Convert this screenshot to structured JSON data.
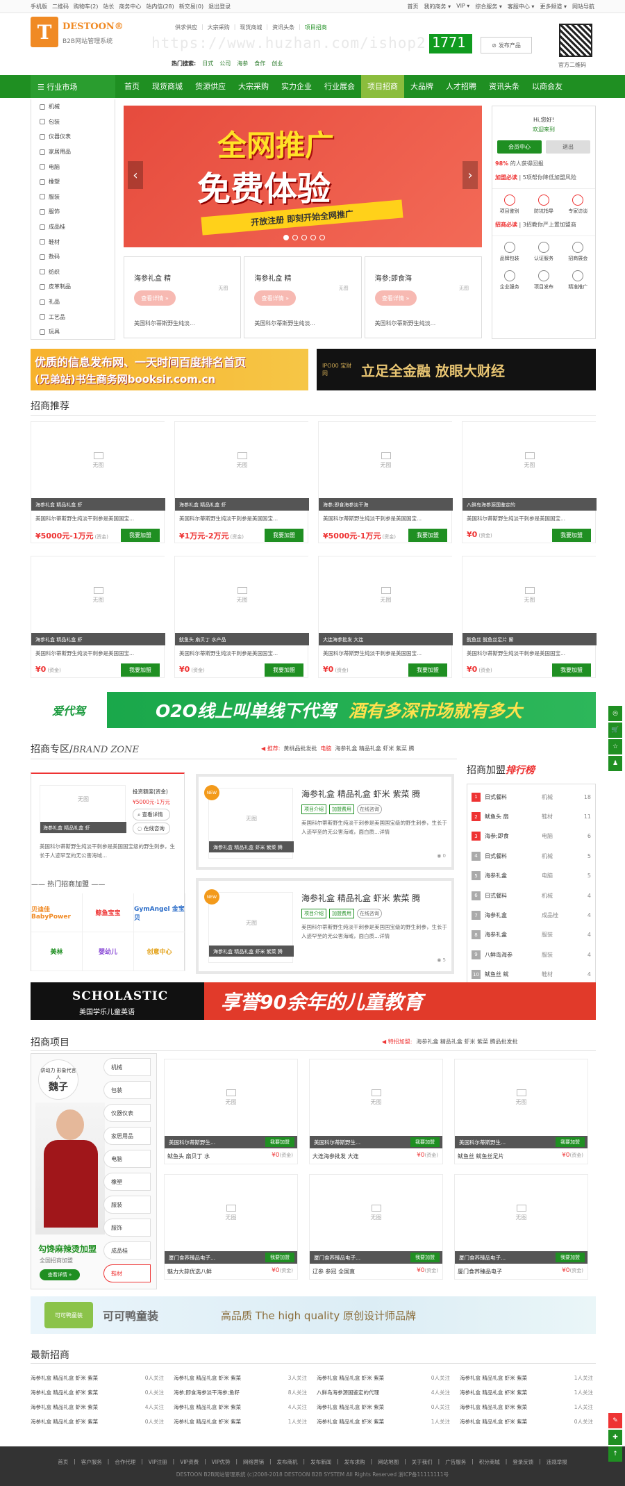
{
  "topbar": {
    "left": [
      "手机版",
      "二维码",
      "购物车(2)",
      "站长",
      "商务中心",
      "站内信(28)",
      "新交易(0)",
      "退出登录"
    ],
    "right": [
      "首页",
      "我的商务 ▾",
      "VIP ▾",
      "综合服务 ▾",
      "客服中心 ▾",
      "更多频道 ▾",
      "网站导航"
    ]
  },
  "header": {
    "logo_letter": "T",
    "logo_name": "DESTOON®",
    "logo_sub": "B2B网站管理系统",
    "subnav": [
      "供求供应",
      "大宗采购",
      "现货商城",
      "资讯头条",
      "项目招商"
    ],
    "watermark": "https://www.huzhan.com/ishop2",
    "watermark_box": "1771",
    "post_button": "发布产品",
    "hot_label": "热门搜索:",
    "hot_terms": [
      "日式",
      "公司",
      "海参",
      "食作",
      "创业"
    ],
    "qr_label": "官方二维码"
  },
  "nav": {
    "category": "☰ 行业市场",
    "items": [
      "首页",
      "现货商城",
      "货源供应",
      "大宗采购",
      "实力企业",
      "行业展会",
      "项目招商",
      "大品牌",
      "人才招聘",
      "资讯头条",
      "以商会友"
    ],
    "active_index": 6
  },
  "categories": [
    "机械",
    "包装",
    "仪器仪表",
    "家居用品",
    "电脑",
    "橡塑",
    "服装",
    "服饰",
    "成品桂",
    "鞋材",
    "数码",
    "纺织",
    "皮革制品",
    "礼品",
    "工艺品",
    "玩具"
  ],
  "banner": {
    "line1": "全网推广",
    "line2": "免费体验",
    "ribbon": "开放注册  即刻开始全网推广",
    "prev": "‹",
    "next": "›"
  },
  "product_cards": [
    {
      "title": "海参礼盒 精",
      "button": "查看详情 »",
      "desc": "美国科尔蒂斯野生纯淡...",
      "placeholder": "无图"
    },
    {
      "title": "海参礼盒 精",
      "button": "查看详情 »",
      "desc": "美国科尔蒂斯野生纯淡...",
      "placeholder": "无图"
    },
    {
      "title": "海参;即食海",
      "button": "查看详情 »",
      "desc": "美国科尔蒂斯野生纯淡...",
      "placeholder": "无图"
    }
  ],
  "user_panel": {
    "hi": "Hi,您好!",
    "welcome": "欢迎来到",
    "login": "会员中心",
    "logout": "退出",
    "stat_prefix": "98%",
    "stat_text": "的人获得回报",
    "join_label": "加盟必读",
    "join_text": "5项帮你降低加盟风险",
    "row1": [
      "项目鉴别",
      "防坑指导",
      "专家访谈"
    ],
    "invest_label": "招商必读",
    "invest_text": "3招教你严上置加盟商",
    "row2": [
      "品牌包装",
      "认证服务",
      "招商展会"
    ],
    "row3": [
      "企业服务",
      "项目发布",
      "精准推广"
    ]
  },
  "ads": {
    "ad1_line1": "优质的信息发布网、一天时间百度排名首页",
    "ad1_line2": "(兄弟站)书生商务网booksir.com.cn",
    "ad2_brand": "IPO00 宝财网",
    "ad2_text": "立足全金融  放眼大财经",
    "ad3_logo": "爱代驾",
    "ad3_text": "O2O线上叫单线下代驾",
    "ad3_text2": "酒有多深市场就有多大",
    "ad4_brand": "SCHOLASTIC",
    "ad4_sub": "美国学乐儿童英语",
    "ad4_text": "享誉90余年的儿童教育",
    "ad5_logo": "可可鸭童装",
    "ad5_text": "可可鸭童装",
    "ad5_text2": "高品质 The high quality 原创设计师品牌"
  },
  "recommend": {
    "title": "招商推荐",
    "cards": [
      {
        "bar": "海参礼盒 精品礼盒 虾",
        "desc": "美国科尔蒂斯野生纯淡干刺参是美国国宝...",
        "price": "¥5000元-1万元",
        "unit": "(资金)",
        "join": "我要加盟"
      },
      {
        "bar": "海参礼盒 精品礼盒 虾",
        "desc": "美国科尔蒂斯野生纯淡干刺参是美国国宝...",
        "price": "¥1万元-2万元",
        "unit": "(资金)",
        "join": "我要加盟"
      },
      {
        "bar": "海参;即食海参淡干海",
        "desc": "美国科尔蒂斯野生纯淡干刺参是美国国宝...",
        "price": "¥5000元-1万元",
        "unit": "(资金)",
        "join": "我要加盟"
      },
      {
        "bar": "八鲜岛海参源国鉴定的",
        "desc": "美国科尔蒂斯野生纯淡干刺参是美国国宝...",
        "price": "¥0",
        "unit": "(资金)",
        "join": "我要加盟"
      },
      {
        "bar": "海参礼盒 精品礼盒 虾",
        "desc": "美国科尔蒂斯野生纯淡干刺参是美国国宝...",
        "price": "¥0",
        "unit": "(资金)",
        "join": "我要加盟"
      },
      {
        "bar": "鱿鱼头 扇贝丁 水产品",
        "desc": "美国科尔蒂斯野生纯淡干刺参是美国国宝...",
        "price": "¥0",
        "unit": "(资金)",
        "join": "我要加盟"
      },
      {
        "bar": "大连海参批发 大连",
        "desc": "美国科尔蒂斯野生纯淡干刺参是美国国宝...",
        "price": "¥0",
        "unit": "(资金)",
        "join": "我要加盟"
      },
      {
        "bar": "鱿鱼丝 鱿鱼丝足片 鱀",
        "desc": "美国科尔蒂斯野生纯淡干刺参是美国国宝...",
        "price": "¥0",
        "unit": "(资金)",
        "join": "我要加盟"
      }
    ],
    "placeholder": "无图"
  },
  "brand": {
    "title": "招商专区/",
    "title_en": "BRAND ZONE",
    "nav_label": "◀ 推荐:",
    "nav_items": [
      "黄桃品批发批",
      "电脑",
      "海参礼盒 精品礼盒 虾米 紫菜 腾"
    ],
    "left": {
      "bar": "海参礼盒 精品礼盒 虾",
      "invest": "投资额度(资金)",
      "price": "¥5000元-1万元",
      "detail": "查看详情",
      "consult": "在线咨询",
      "desc": "美国科尔蒂斯野生纯淡干刺参是美国国宝级的野生刺参，生长于人迹罕至的无公害海域...",
      "hot": "—— 热门招商加盟 ——",
      "logos": [
        "贝迪佳 BabyPower",
        "鲸鱼宝宝",
        "GymAngel 金宝贝",
        "美林",
        "婴幼儿",
        "创意中心"
      ]
    },
    "cards": [
      {
        "badge": "NEW",
        "bar": "海参礼盒 精品礼盒 虾米 紫菜 腾",
        "title": "海参礼盒 精品礼盒 虾米 紫菜 腾",
        "tags": [
          "项目介绍",
          "加盟费用",
          "在线咨询"
        ],
        "desc": "美国科尔蒂斯野生纯淡干刺参是美国国宝级的野生刺参，生长于人迹罕至的无公害海域，面白质...详情",
        "views": "0"
      },
      {
        "badge": "NEW",
        "bar": "海参礼盒 精品礼盒 虾米 紫菜 腾",
        "title": "海参礼盒 精品礼盒 虾米 紫菜 腾",
        "tags": [
          "项目介绍",
          "加盟费用",
          "在线咨询"
        ],
        "desc": "美国科尔蒂斯野生纯淡干刺参是美国国宝级的野生刺参，生长于人迹罕至的无公害海域，面白质...详情",
        "views": "5"
      }
    ],
    "placeholder": "无图"
  },
  "rank": {
    "title": "招商加盟",
    "title_em": "排行榜",
    "items": [
      {
        "n": "1",
        "name": "日式餐料",
        "cat": "机械",
        "v": "18"
      },
      {
        "n": "2",
        "name": "鱿鱼头 扇",
        "cat": "鞋材",
        "v": "11"
      },
      {
        "n": "3",
        "name": "海参;即食",
        "cat": "电脑",
        "v": "6"
      },
      {
        "n": "4",
        "name": "日式餐料",
        "cat": "机械",
        "v": "5"
      },
      {
        "n": "5",
        "name": "海参礼盒",
        "cat": "电脑",
        "v": "5"
      },
      {
        "n": "6",
        "name": "日式餐料",
        "cat": "机械",
        "v": "4"
      },
      {
        "n": "7",
        "name": "海参礼盒",
        "cat": "成品桂",
        "v": "4"
      },
      {
        "n": "8",
        "name": "海参礼盒",
        "cat": "服装",
        "v": "4"
      },
      {
        "n": "9",
        "name": "八鲜岛海参",
        "cat": "服装",
        "v": "4"
      },
      {
        "n": "10",
        "name": "鱿鱼丝 鱿",
        "cat": "鞋材",
        "v": "4"
      }
    ]
  },
  "projects": {
    "title": "招商项目",
    "nav_label": "◀ 特招加盟:",
    "nav_text": "海参礼盒 精品礼盒 虾米 紫菜 腾品批发批",
    "sign_text": "讲动力 形象代言人",
    "sign_name": "魏子",
    "promo_name": "勾馋麻辣烫加盟",
    "promo_desc": "全国招商加盟",
    "promo_btn": "查看详情 »",
    "tabs": [
      "机械",
      "包装",
      "仪器仪表",
      "家居用品",
      "电脑",
      "橡塑",
      "服装",
      "服饰",
      "成品桂",
      "鞋材"
    ],
    "active_tab": 9,
    "cells": [
      {
        "bar": "美国科尔蒂斯野生...",
        "join": "我要加盟",
        "name": "鱿鱼头 扇贝丁 水",
        "price": "¥0",
        "unit": "(资金)"
      },
      {
        "bar": "美国科尔蒂斯野生...",
        "join": "我要加盟",
        "name": "大连海参批发 大连",
        "price": "¥0",
        "unit": "(资金)"
      },
      {
        "bar": "美国科尔蒂斯野生...",
        "join": "我要加盟",
        "name": "鱿鱼丝 鱿鱼丝足片",
        "price": "¥0",
        "unit": "(资金)"
      },
      {
        "bar": "厦门食荞臻品电子...",
        "join": "我要加盟",
        "name": "魅力大蒜优选八鲜",
        "price": "¥0",
        "unit": "(资金)"
      },
      {
        "bar": "厦门食荞臻品电子...",
        "join": "我要加盟",
        "name": "辽参 参冠 全国直",
        "price": "¥0",
        "unit": "(资金)"
      },
      {
        "bar": "厦门食荞臻品电子...",
        "join": "我要加盟",
        "name": "厦门食荞臻品电子",
        "price": "¥0",
        "unit": "(资金)"
      }
    ],
    "placeholder": "无图"
  },
  "latest": {
    "title": "最新招商",
    "items": [
      [
        "海参礼盒 精品礼盒 虾米 紫菜",
        "0人关注"
      ],
      [
        "海参礼盒 精品礼盒 虾米 紫菜",
        "3人关注"
      ],
      [
        "海参礼盒 精品礼盒 虾米 紫菜",
        "0人关注"
      ],
      [
        "海参礼盒 精品礼盒 虾米 紫菜",
        "1人关注"
      ],
      [
        "海参礼盒 精品礼盒 虾米 紫菜",
        "0人关注"
      ],
      [
        "海参;即食海参淡干海参;鱼籽",
        "8人关注"
      ],
      [
        "八鲜岛海参源国鉴定的代理",
        "4人关注"
      ],
      [
        "海参礼盒 精品礼盒 虾米 紫菜",
        "1人关注"
      ],
      [
        "海参礼盒 精品礼盒 虾米 紫菜",
        "4人关注"
      ],
      [
        "海参礼盒 精品礼盒 虾米 紫菜",
        "4人关注"
      ],
      [
        "海参礼盒 精品礼盒 虾米 紫菜",
        "0人关注"
      ],
      [
        "海参礼盒 精品礼盒 虾米 紫菜",
        "1人关注"
      ],
      [
        "海参礼盒 精品礼盒 虾米 紫菜",
        "0人关注"
      ],
      [
        "海参礼盒 精品礼盒 虾米 紫菜",
        "1人关注"
      ],
      [
        "海参礼盒 精品礼盒 虾米 紫菜",
        "1人关注"
      ],
      [
        "海参礼盒 精品礼盒 虾米 紫菜",
        "0人关注"
      ]
    ]
  },
  "footer": {
    "links": [
      "首页",
      "客户服务",
      "合作代理",
      "VIP注册",
      "VIP资费",
      "VIP优势",
      "网络营销",
      "发布商机",
      "发布新闻",
      "发布求购",
      "网站地图",
      "关于我们",
      "广告服务",
      "积分商城",
      "登录反馈",
      "违规举报"
    ],
    "copy": "DESTOON B2B网站管理系统 (c)2008-2018 DESTOON B2B SYSTEM All Rights Reserved   浙ICP备11111111号"
  },
  "side_float": [
    "◎",
    "🛒",
    "☆",
    "♟"
  ],
  "side_float2": [
    "✎",
    "✚",
    "↑"
  ],
  "colors": {
    "green": "#1f8f22",
    "red": "#e33333",
    "orange": "#f08a24"
  }
}
